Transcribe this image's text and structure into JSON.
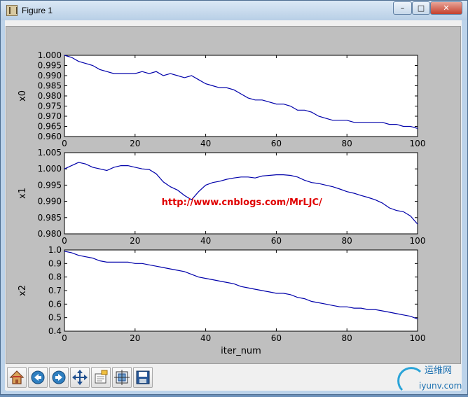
{
  "window": {
    "title": "Figure 1",
    "minimize": "–",
    "maximize": "□",
    "close": "✕"
  },
  "chart_data": [
    {
      "type": "line",
      "ylabel": "x0",
      "xlim": [
        0,
        100
      ],
      "ylim": [
        0.96,
        1.0
      ],
      "yticks": [
        "1.000",
        "0.995",
        "0.990",
        "0.985",
        "0.980",
        "0.975",
        "0.970",
        "0.965",
        "0.960"
      ],
      "xticks": [
        "0",
        "20",
        "40",
        "60",
        "80",
        "100"
      ],
      "color": "#0000aa",
      "x": [
        0,
        2,
        4,
        6,
        8,
        10,
        12,
        14,
        16,
        18,
        20,
        22,
        24,
        26,
        28,
        30,
        32,
        34,
        36,
        38,
        40,
        42,
        44,
        46,
        48,
        50,
        52,
        54,
        56,
        58,
        60,
        62,
        64,
        66,
        68,
        70,
        72,
        74,
        76,
        78,
        80,
        82,
        84,
        86,
        88,
        90,
        92,
        94,
        96,
        98,
        100
      ],
      "values": [
        1.0,
        0.999,
        0.997,
        0.996,
        0.995,
        0.993,
        0.992,
        0.991,
        0.991,
        0.991,
        0.991,
        0.992,
        0.991,
        0.992,
        0.99,
        0.991,
        0.99,
        0.989,
        0.99,
        0.988,
        0.986,
        0.985,
        0.984,
        0.984,
        0.983,
        0.981,
        0.979,
        0.978,
        0.978,
        0.977,
        0.976,
        0.976,
        0.975,
        0.973,
        0.973,
        0.972,
        0.97,
        0.969,
        0.968,
        0.968,
        0.968,
        0.967,
        0.967,
        0.967,
        0.967,
        0.967,
        0.966,
        0.966,
        0.965,
        0.965,
        0.964
      ]
    },
    {
      "type": "line",
      "ylabel": "x1",
      "xlim": [
        0,
        100
      ],
      "ylim": [
        0.98,
        1.005
      ],
      "yticks": [
        "1.005",
        "1.000",
        "0.995",
        "0.990",
        "0.985",
        "0.980"
      ],
      "xticks": [
        "0",
        "20",
        "40",
        "60",
        "80",
        "100"
      ],
      "color": "#0000aa",
      "annotation": "http://www.cnblogs.com/MrLJC/",
      "x": [
        0,
        2,
        4,
        6,
        8,
        10,
        12,
        14,
        16,
        18,
        20,
        22,
        24,
        26,
        28,
        30,
        32,
        34,
        36,
        38,
        40,
        42,
        44,
        46,
        48,
        50,
        52,
        54,
        56,
        58,
        60,
        62,
        64,
        66,
        68,
        70,
        72,
        74,
        76,
        78,
        80,
        82,
        84,
        86,
        88,
        90,
        92,
        94,
        96,
        98,
        100
      ],
      "values": [
        1.0,
        1.001,
        1.002,
        1.0015,
        1.0005,
        1.0,
        0.9995,
        1.0005,
        1.001,
        1.001,
        1.0005,
        1.0,
        0.9998,
        0.9985,
        0.996,
        0.9945,
        0.9935,
        0.9918,
        0.9905,
        0.993,
        0.995,
        0.9958,
        0.9962,
        0.9968,
        0.9972,
        0.9975,
        0.9975,
        0.9972,
        0.9978,
        0.998,
        0.9982,
        0.9982,
        0.998,
        0.9975,
        0.9965,
        0.9958,
        0.9955,
        0.995,
        0.9945,
        0.9938,
        0.993,
        0.9925,
        0.9918,
        0.9912,
        0.9905,
        0.9895,
        0.988,
        0.9872,
        0.9868,
        0.9855,
        0.983
      ]
    },
    {
      "type": "line",
      "ylabel": "x2",
      "xlabel": "iter_num",
      "xlim": [
        0,
        100
      ],
      "ylim": [
        0.4,
        1.0
      ],
      "yticks": [
        "1.0",
        "0.9",
        "0.8",
        "0.7",
        "0.6",
        "0.5",
        "0.4"
      ],
      "xticks": [
        "0",
        "20",
        "40",
        "60",
        "80",
        "100"
      ],
      "color": "#0000aa",
      "x": [
        0,
        2,
        4,
        6,
        8,
        10,
        12,
        14,
        16,
        18,
        20,
        22,
        24,
        26,
        28,
        30,
        32,
        34,
        36,
        38,
        40,
        42,
        44,
        46,
        48,
        50,
        52,
        54,
        56,
        58,
        60,
        62,
        64,
        66,
        68,
        70,
        72,
        74,
        76,
        78,
        80,
        82,
        84,
        86,
        88,
        90,
        92,
        94,
        96,
        98,
        100
      ],
      "values": [
        0.99,
        0.98,
        0.96,
        0.95,
        0.94,
        0.92,
        0.91,
        0.91,
        0.91,
        0.91,
        0.9,
        0.9,
        0.89,
        0.88,
        0.87,
        0.86,
        0.85,
        0.84,
        0.82,
        0.8,
        0.79,
        0.78,
        0.77,
        0.76,
        0.75,
        0.73,
        0.72,
        0.71,
        0.7,
        0.69,
        0.68,
        0.68,
        0.67,
        0.65,
        0.64,
        0.62,
        0.61,
        0.6,
        0.59,
        0.58,
        0.58,
        0.57,
        0.57,
        0.56,
        0.56,
        0.55,
        0.54,
        0.53,
        0.52,
        0.51,
        0.49
      ]
    }
  ],
  "toolbar": [
    {
      "name": "home-button",
      "icon": "home-icon"
    },
    {
      "name": "back-button",
      "icon": "back-arrow-icon"
    },
    {
      "name": "forward-button",
      "icon": "forward-arrow-icon"
    },
    {
      "name": "pan-button",
      "icon": "move-icon"
    },
    {
      "name": "zoom-button",
      "icon": "zoom-rect-icon"
    },
    {
      "name": "subplots-button",
      "icon": "subplots-icon"
    },
    {
      "name": "save-button",
      "icon": "save-icon"
    }
  ],
  "watermark": {
    "brand": "运维网",
    "site": "iyunv.com"
  }
}
